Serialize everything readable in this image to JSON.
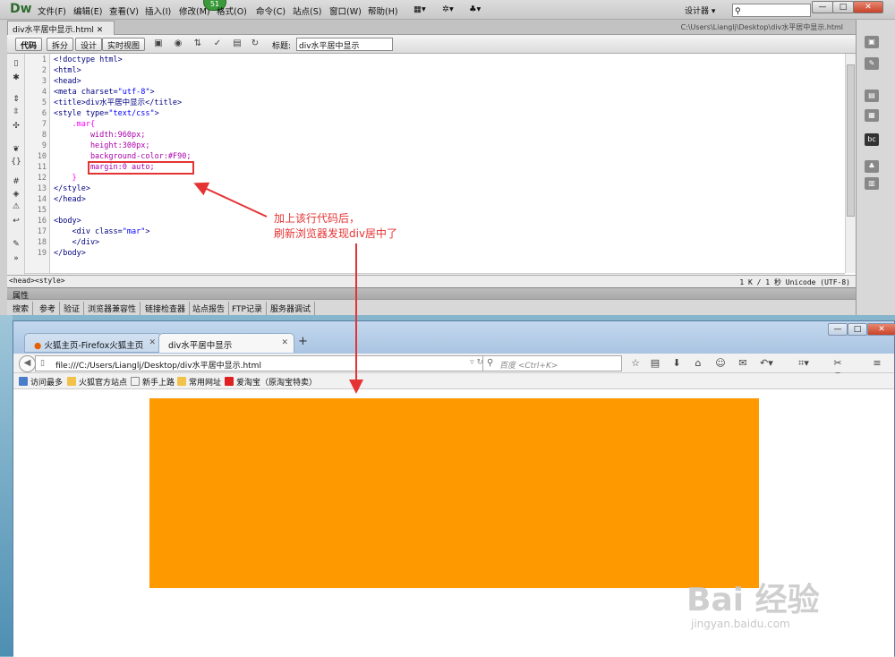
{
  "dw": {
    "logo": "Dw",
    "menus": [
      "文件(F)",
      "编辑(E)",
      "查看(V)",
      "插入(I)",
      "修改(M)",
      "格式(O)",
      "命令(C)",
      "站点(S)",
      "窗口(W)",
      "帮助(H)"
    ],
    "badge": "51",
    "layout_mode": "设计器",
    "doc_tab": "div水平居中显示.html",
    "doc_path": "C:\\Users\\Lianglj\\Desktop\\div水平居中显示.html",
    "view_buttons": [
      "代码",
      "拆分",
      "设计",
      "实时视图"
    ],
    "title_label": "标题:",
    "title_value": "div水平居中显示",
    "line_numbers": [
      "1",
      "2",
      "3",
      "4",
      "5",
      "6",
      "7",
      "8",
      "9",
      "10",
      "11",
      "12",
      "13",
      "14",
      "15",
      "16",
      "17",
      "18",
      "19"
    ],
    "tag_selector": "<head><style>",
    "status_right": "1 K / 1 秒 Unicode (UTF-8)",
    "props_label": "属性",
    "bottom_tabs": [
      "搜索",
      "参考",
      "验证",
      "浏览器兼容性",
      "链接检查器",
      "站点报告",
      "FTP记录",
      "服务器调试"
    ]
  },
  "code": {
    "l1": "<!doctype html>",
    "l2": "<html>",
    "l3": "<head>",
    "l4a": "<meta charset=",
    "l4b": "\"utf-8\"",
    "l4c": ">",
    "l5": "<title>div水平居中显示</title>",
    "l6a": "<style type=",
    "l6b": "\"text/css\"",
    "l6c": ">",
    "l7": "    .mar{",
    "l8": "        width:960px;",
    "l9": "        height:300px;",
    "l10": "        background-color:#F90;",
    "l11": "        margin:0 auto;",
    "l12": "    }",
    "l13": "</style>",
    "l14": "</head>",
    "l15": "",
    "l16": "<body>",
    "l17a": "    <div class=",
    "l17b": "\"mar\"",
    "l17c": ">",
    "l18": "    </div>",
    "l19": "</body>"
  },
  "annotation": {
    "line1": "加上该行代码后，",
    "line2": "刷新浏览器发现div居中了"
  },
  "ff": {
    "tab1": "火狐主页-Firefox火狐主页",
    "tab2": "div水平居中显示",
    "url": "file:///C:/Users/Lianglj/Desktop/div水平居中显示.html",
    "search_placeholder": "百度 <Ctrl+K>",
    "bookmarks": [
      "访问最多",
      "火狐官方站点",
      "新手上路",
      "常用网址",
      "爱淘宝（原淘宝特卖）"
    ]
  },
  "watermark": {
    "main": "Bai 经验",
    "sub": "jingyan.baidu.com"
  },
  "colors": {
    "div_background": "#FF9900",
    "annotation": "#e53333"
  }
}
